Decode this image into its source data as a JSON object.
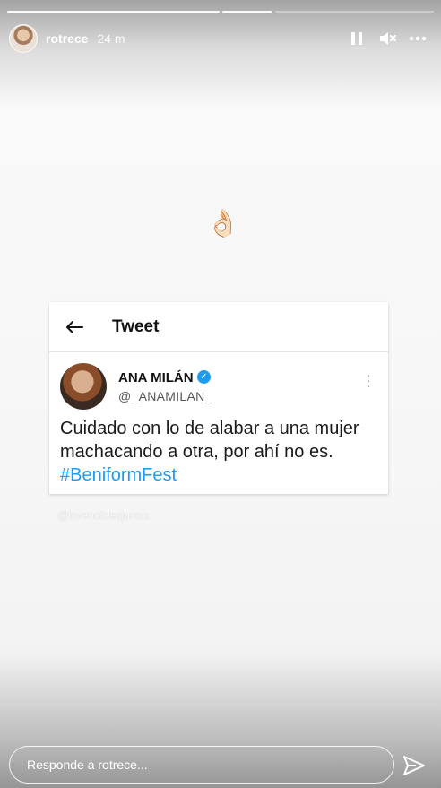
{
  "story": {
    "username": "rotrece",
    "time": "24 m",
    "progress_segments": 3
  },
  "emoji": "👌🏻",
  "tweet": {
    "header_title": "Tweet",
    "author_name": "ANA MILÁN",
    "author_handle": "@_ANAMILAN_",
    "text": "Cuidado con lo de alabar a una mujer machacando a otra, por ahí no es.",
    "hashtag": "#BeniformFest"
  },
  "watermark": "@invenciblesjuntxs",
  "reply": {
    "placeholder": "Responde a rotrece..."
  },
  "icons": {
    "pause": "pause-icon",
    "mute": "mute-icon",
    "more": "more-icon",
    "back": "back-arrow-icon",
    "verified": "verified-icon",
    "send": "send-icon"
  },
  "colors": {
    "accent_blue": "#1d9bf0"
  }
}
